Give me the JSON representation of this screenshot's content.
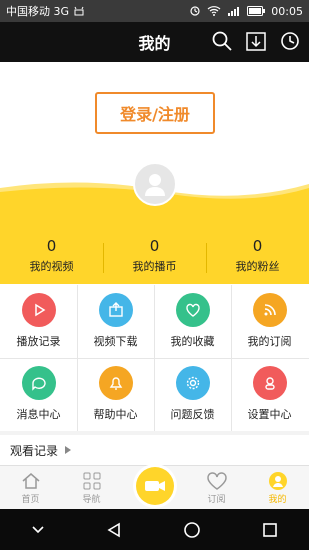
{
  "status": {
    "carrier": "中国移动 3G",
    "time": "00:05",
    "icons": [
      "alarm-icon",
      "wifi-icon",
      "signal-icon",
      "battery-icon",
      "android-icon"
    ]
  },
  "header": {
    "title": "我的",
    "icons": [
      "search-icon",
      "download-icon",
      "clock-icon"
    ]
  },
  "login": {
    "label": "登录/注册"
  },
  "stats": [
    {
      "value": "0",
      "label": "我的视频"
    },
    {
      "value": "0",
      "label": "我的播币"
    },
    {
      "value": "0",
      "label": "我的粉丝"
    }
  ],
  "grid": [
    {
      "label": "播放记录",
      "color": "#f15b5b",
      "icon": "play-icon"
    },
    {
      "label": "视频下载",
      "color": "#44b6e8",
      "icon": "upload-icon"
    },
    {
      "label": "我的收藏",
      "color": "#35c18b",
      "icon": "heart-icon"
    },
    {
      "label": "我的订阅",
      "color": "#f5a623",
      "icon": "rss-icon"
    },
    {
      "label": "消息中心",
      "color": "#35c18b",
      "icon": "chat-icon"
    },
    {
      "label": "帮助中心",
      "color": "#f5a623",
      "icon": "bell-icon"
    },
    {
      "label": "问题反馈",
      "color": "#44b6e8",
      "icon": "gear-icon"
    },
    {
      "label": "设置中心",
      "color": "#f15b5b",
      "icon": "user-icon"
    }
  ],
  "history": {
    "label": "观看记录"
  },
  "tabbar": [
    {
      "label": "首页",
      "icon": "home-icon"
    },
    {
      "label": "导航",
      "icon": "grid-icon"
    },
    {
      "label": "",
      "icon": "camera-icon"
    },
    {
      "label": "订阅",
      "icon": "heart-outline-icon"
    },
    {
      "label": "我的",
      "icon": "profile-icon",
      "active": true
    }
  ],
  "colors": {
    "accent": "#ffd52a",
    "orange": "#f08a2b"
  }
}
